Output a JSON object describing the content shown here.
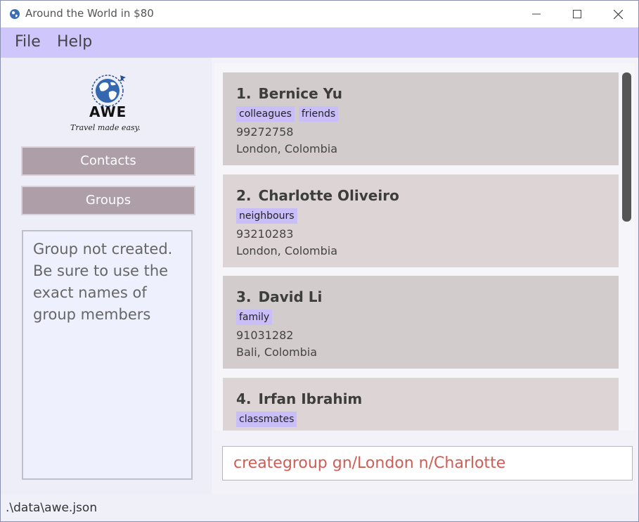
{
  "window": {
    "title": "Around the World in $80",
    "icon": "globe-icon"
  },
  "menu": {
    "items": [
      "File",
      "Help"
    ]
  },
  "logo": {
    "brand": "AWE",
    "tagline": "Travel made easy."
  },
  "nav": {
    "contacts_label": "Contacts",
    "groups_label": "Groups"
  },
  "result": {
    "message": "Group not created. Be sure to use the exact names of group members"
  },
  "contacts": [
    {
      "index": "1.",
      "name": "Bernice Yu",
      "tags": [
        "colleagues",
        "friends"
      ],
      "phone": "99272758",
      "location": "London, Colombia"
    },
    {
      "index": "2.",
      "name": "Charlotte Oliveiro",
      "tags": [
        "neighbours"
      ],
      "phone": "93210283",
      "location": "London, Colombia"
    },
    {
      "index": "3.",
      "name": "David Li",
      "tags": [
        "family"
      ],
      "phone": "91031282",
      "location": "Bali, Colombia"
    },
    {
      "index": "4.",
      "name": "Irfan Ibrahim",
      "tags": [
        "classmates"
      ],
      "phone": "",
      "location": ""
    }
  ],
  "command": {
    "value": "creategroup gn/London n/Charlotte"
  },
  "status": {
    "path": ".\\data\\awe.json"
  },
  "colors": {
    "menubar": "#cfc6fb",
    "tag": "#c9bef8",
    "nav_button": "#ad9ea7",
    "card_odd": "#d2cccd",
    "card_even": "#ddd4d5",
    "command_text": "#d05d55"
  }
}
